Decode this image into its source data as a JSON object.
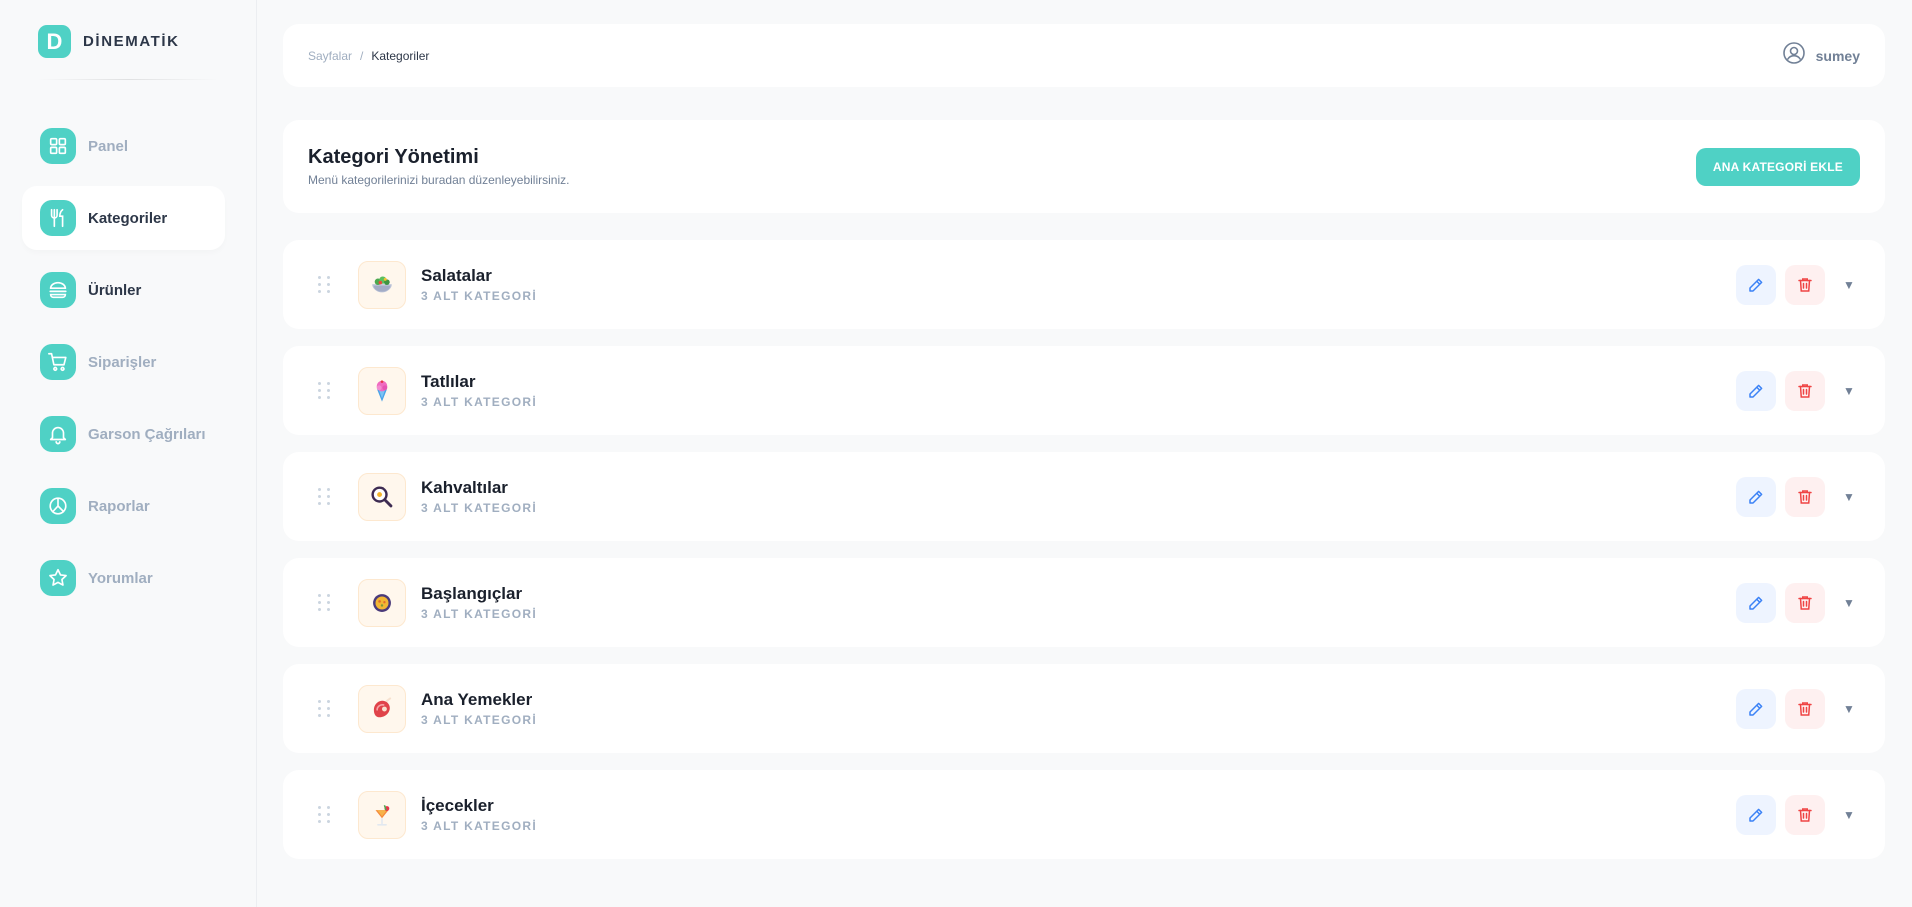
{
  "brand": {
    "logo_letter": "D",
    "name": "DİNEMATİK"
  },
  "nav": [
    {
      "label": "Panel",
      "icon": "grid-icon"
    },
    {
      "label": "Kategoriler",
      "icon": "utensils-icon",
      "active": true
    },
    {
      "label": "Ürünler",
      "icon": "burger-icon"
    },
    {
      "label": "Siparişler",
      "icon": "cart-icon"
    },
    {
      "label": "Garson Çağrıları",
      "icon": "bell-icon"
    },
    {
      "label": "Raporlar",
      "icon": "pie-chart-icon"
    },
    {
      "label": "Yorumlar",
      "icon": "star-icon"
    }
  ],
  "topbar": {
    "breadcrumb_root": "Sayfalar",
    "breadcrumb_sep": "/",
    "breadcrumb_current": "Kategoriler",
    "user_name": "sumey"
  },
  "header": {
    "title": "Kategori Yönetimi",
    "subtitle": "Menü kategorilerinizi buradan düzenleyebilirsiniz.",
    "add_button": "ANA KATEGORİ EKLE"
  },
  "categories": [
    {
      "name": "Salatalar",
      "count": "3 ALT KATEGORİ",
      "icon": "salad-icon"
    },
    {
      "name": "Tatlılar",
      "count": "3 ALT KATEGORİ",
      "icon": "ice-cream-icon"
    },
    {
      "name": "Kahvaltılar",
      "count": "3 ALT KATEGORİ",
      "icon": "frying-pan-icon"
    },
    {
      "name": "Başlangıçlar",
      "count": "3 ALT KATEGORİ",
      "icon": "soup-bowl-icon"
    },
    {
      "name": "Ana Yemekler",
      "count": "3 ALT KATEGORİ",
      "icon": "meat-icon"
    },
    {
      "name": "İçecekler",
      "count": "3 ALT KATEGORİ",
      "icon": "cocktail-icon"
    }
  ],
  "colors": {
    "accent": "#4fd1c5",
    "edit": "#3b82f6",
    "delete": "#ef4444"
  }
}
